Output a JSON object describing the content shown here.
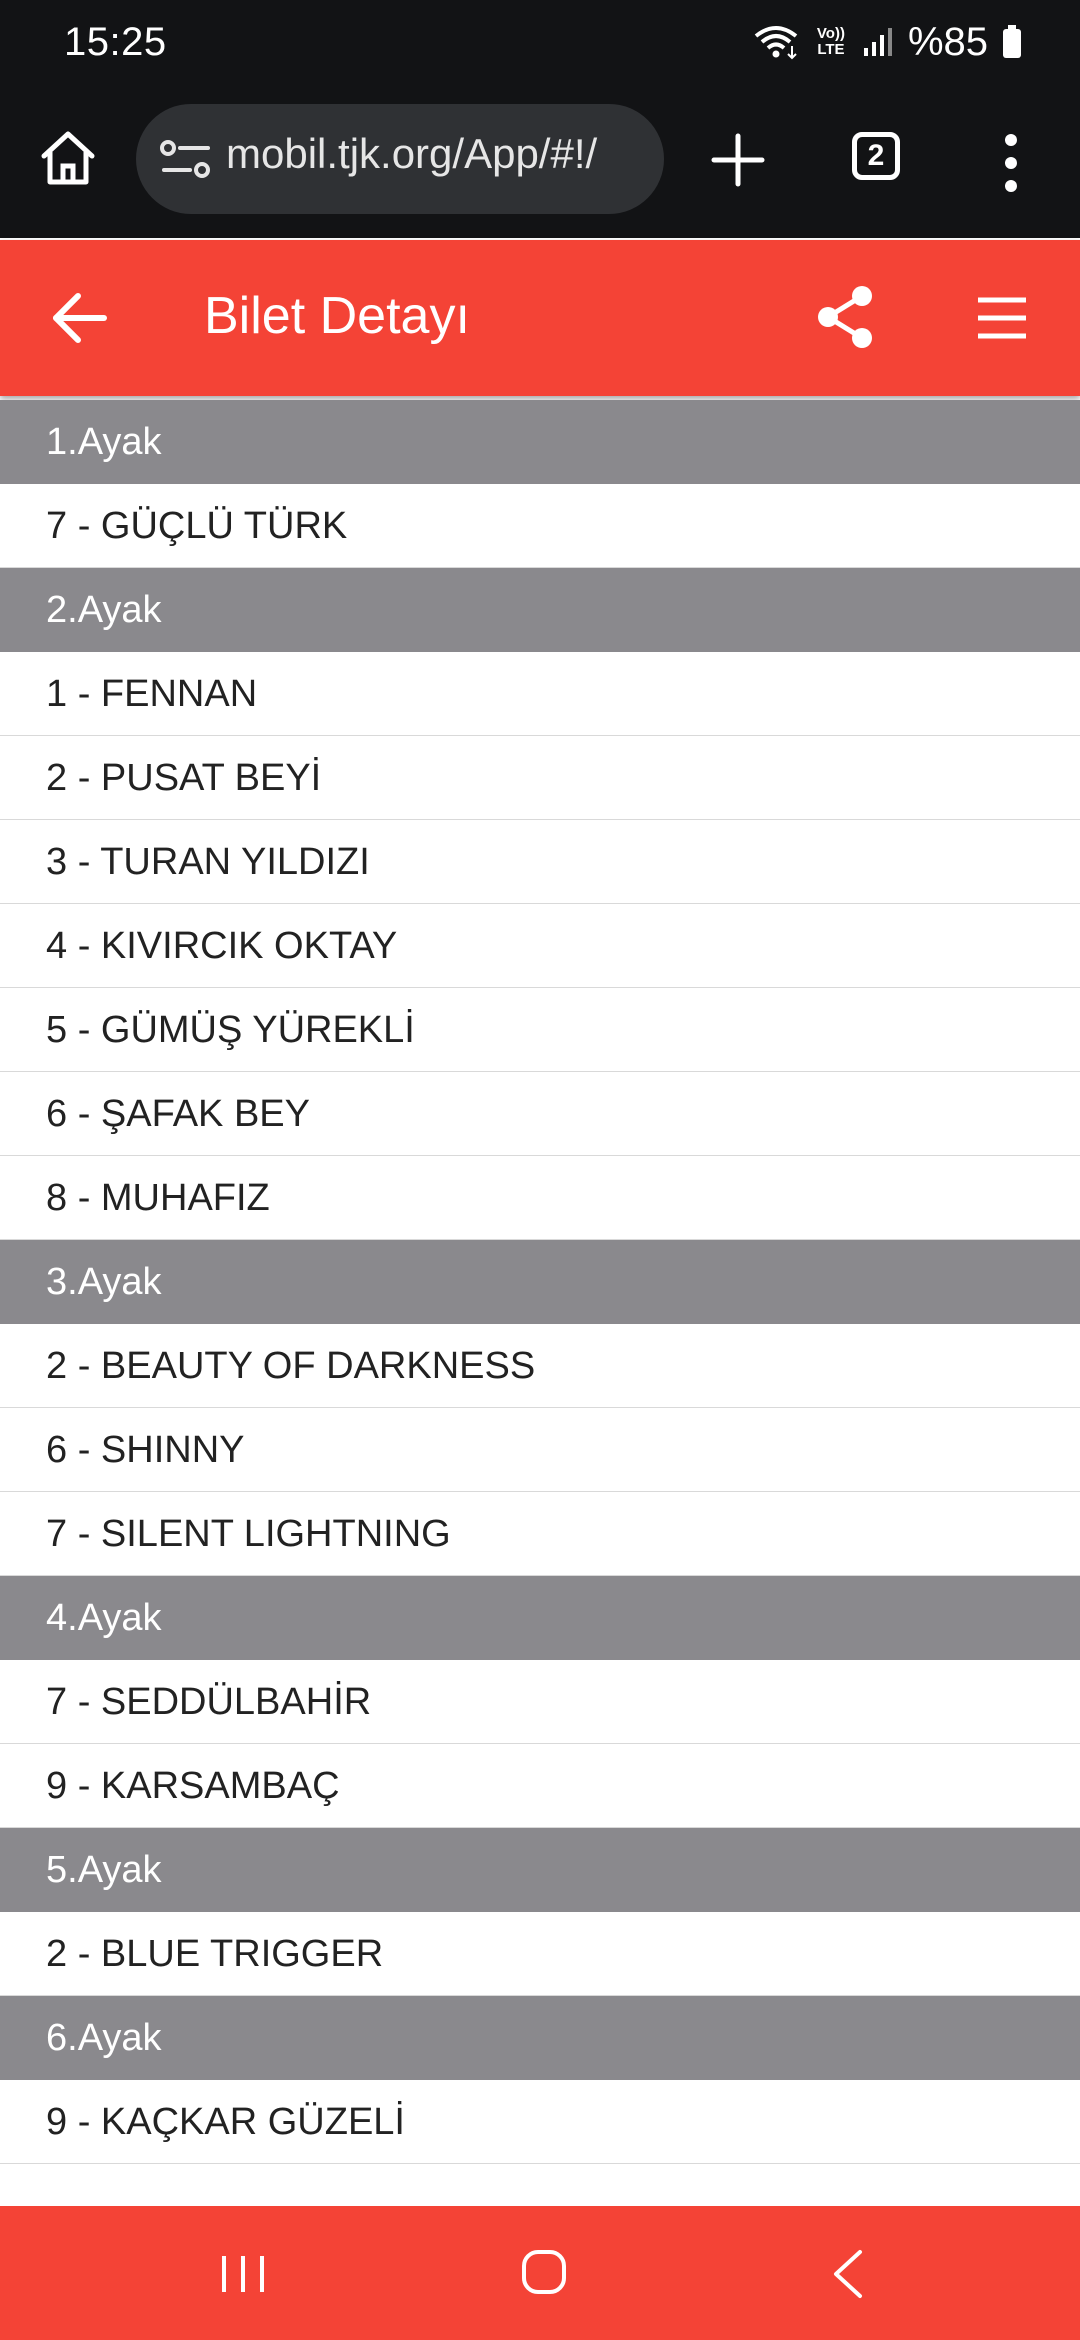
{
  "status_bar": {
    "time": "15:25",
    "battery": "%85",
    "network_label": "Vo)) LTE"
  },
  "browser": {
    "url": "mobil.tjk.org/App/#!/",
    "tab_count": "2"
  },
  "app_bar": {
    "title": "Bilet Detayı"
  },
  "groups": [
    {
      "header": "1.Ayak",
      "items": [
        "7 - GÜÇLÜ TÜRK"
      ]
    },
    {
      "header": "2.Ayak",
      "items": [
        "1 - FENNAN",
        "2 - PUSAT BEYİ",
        "3 - TURAN YILDIZI",
        "4 - KIVIRCIK OKTAY",
        "5 - GÜMÜŞ YÜREKLİ",
        "6 - ŞAFAK BEY",
        "8 - MUHAFIZ"
      ]
    },
    {
      "header": "3.Ayak",
      "items": [
        "2 - BEAUTY OF DARKNESS",
        "6 - SHINNY",
        "7 - SILENT LIGHTNING"
      ]
    },
    {
      "header": "4.Ayak",
      "items": [
        "7 - SEDDÜLBAHİR",
        "9 - KARSAMBAÇ"
      ]
    },
    {
      "header": "5.Ayak",
      "items": [
        "2 - BLUE TRIGGER"
      ]
    },
    {
      "header": "6.Ayak",
      "items": [
        "9 - KAÇKAR GÜZELİ"
      ]
    }
  ],
  "colors": {
    "accent": "#f44336",
    "group_header_bg": "#8a898d",
    "browser_bg": "#121315"
  }
}
